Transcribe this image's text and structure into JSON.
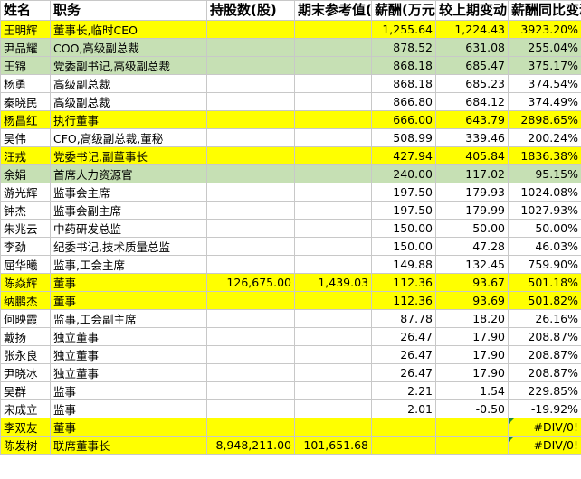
{
  "headers": {
    "name": "姓名",
    "position": "职务",
    "shares": "持股数(股)",
    "value": "期末参考值(万元)",
    "salary": "薪酬(万元)",
    "change": "较上期变动(万元)",
    "yoy": "薪酬同比变动"
  },
  "rows": [
    {
      "name": "王明辉",
      "position": "董事长,临时CEO",
      "shares": "",
      "value": "",
      "salary": "1,255.64",
      "change": "1,224.43",
      "yoy": "3923.20%",
      "highlight": "yellow"
    },
    {
      "name": "尹品耀",
      "position": "COO,高级副总裁",
      "shares": "",
      "value": "",
      "salary": "878.52",
      "change": "631.08",
      "yoy": "255.04%",
      "highlight": "green"
    },
    {
      "name": "王锦",
      "position": "党委副书记,高级副总裁",
      "shares": "",
      "value": "",
      "salary": "868.18",
      "change": "685.47",
      "yoy": "375.17%",
      "highlight": "green"
    },
    {
      "name": "杨勇",
      "position": "高级副总裁",
      "shares": "",
      "value": "",
      "salary": "868.18",
      "change": "685.23",
      "yoy": "374.54%",
      "highlight": ""
    },
    {
      "name": "秦晓民",
      "position": "高级副总裁",
      "shares": "",
      "value": "",
      "salary": "866.80",
      "change": "684.12",
      "yoy": "374.49%",
      "highlight": ""
    },
    {
      "name": "杨昌红",
      "position": "执行董事",
      "shares": "",
      "value": "",
      "salary": "666.00",
      "change": "643.79",
      "yoy": "2898.65%",
      "highlight": "yellow"
    },
    {
      "name": "吴伟",
      "position": "CFO,高级副总裁,董秘",
      "shares": "",
      "value": "",
      "salary": "508.99",
      "change": "339.46",
      "yoy": "200.24%",
      "highlight": ""
    },
    {
      "name": "汪戎",
      "position": "党委书记,副董事长",
      "shares": "",
      "value": "",
      "salary": "427.94",
      "change": "405.84",
      "yoy": "1836.38%",
      "highlight": "yellow"
    },
    {
      "name": "余娟",
      "position": "首席人力资源官",
      "shares": "",
      "value": "",
      "salary": "240.00",
      "change": "117.02",
      "yoy": "95.15%",
      "highlight": "green"
    },
    {
      "name": "游光辉",
      "position": "监事会主席",
      "shares": "",
      "value": "",
      "salary": "197.50",
      "change": "179.93",
      "yoy": "1024.08%",
      "highlight": ""
    },
    {
      "name": "钟杰",
      "position": "监事会副主席",
      "shares": "",
      "value": "",
      "salary": "197.50",
      "change": "179.99",
      "yoy": "1027.93%",
      "highlight": ""
    },
    {
      "name": "朱兆云",
      "position": "中药研发总监",
      "shares": "",
      "value": "",
      "salary": "150.00",
      "change": "50.00",
      "yoy": "50.00%",
      "highlight": ""
    },
    {
      "name": "李劲",
      "position": "纪委书记,技术质量总监",
      "shares": "",
      "value": "",
      "salary": "150.00",
      "change": "47.28",
      "yoy": "46.03%",
      "highlight": ""
    },
    {
      "name": "屈华曦",
      "position": "监事,工会主席",
      "shares": "",
      "value": "",
      "salary": "149.88",
      "change": "132.45",
      "yoy": "759.90%",
      "highlight": ""
    },
    {
      "name": "陈焱辉",
      "position": "董事",
      "shares": "126,675.00",
      "value": "1,439.03",
      "salary": "112.36",
      "change": "93.67",
      "yoy": "501.18%",
      "highlight": "yellow"
    },
    {
      "name": "纳鹏杰",
      "position": "董事",
      "shares": "",
      "value": "",
      "salary": "112.36",
      "change": "93.69",
      "yoy": "501.82%",
      "highlight": "yellow"
    },
    {
      "name": "何映霞",
      "position": "监事,工会副主席",
      "shares": "",
      "value": "",
      "salary": "87.78",
      "change": "18.20",
      "yoy": "26.16%",
      "highlight": ""
    },
    {
      "name": "戴扬",
      "position": "独立董事",
      "shares": "",
      "value": "",
      "salary": "26.47",
      "change": "17.90",
      "yoy": "208.87%",
      "highlight": ""
    },
    {
      "name": "张永良",
      "position": "独立董事",
      "shares": "",
      "value": "",
      "salary": "26.47",
      "change": "17.90",
      "yoy": "208.87%",
      "highlight": ""
    },
    {
      "name": "尹晓冰",
      "position": "独立董事",
      "shares": "",
      "value": "",
      "salary": "26.47",
      "change": "17.90",
      "yoy": "208.87%",
      "highlight": ""
    },
    {
      "name": "吴群",
      "position": "监事",
      "shares": "",
      "value": "",
      "salary": "2.21",
      "change": "1.54",
      "yoy": "229.85%",
      "highlight": ""
    },
    {
      "name": "宋成立",
      "position": "监事",
      "shares": "",
      "value": "",
      "salary": "2.01",
      "change": "-0.50",
      "yoy": "-19.92%",
      "highlight": ""
    },
    {
      "name": "李双友",
      "position": "董事",
      "shares": "",
      "value": "",
      "salary": "",
      "change": "",
      "yoy": "#DIV/0!",
      "highlight": "yellow"
    },
    {
      "name": "陈发树",
      "position": "联席董事长",
      "shares": "8,948,211.00",
      "value": "101,651.68",
      "salary": "",
      "change": "",
      "yoy": "#DIV/0!",
      "highlight": "yellow"
    }
  ]
}
